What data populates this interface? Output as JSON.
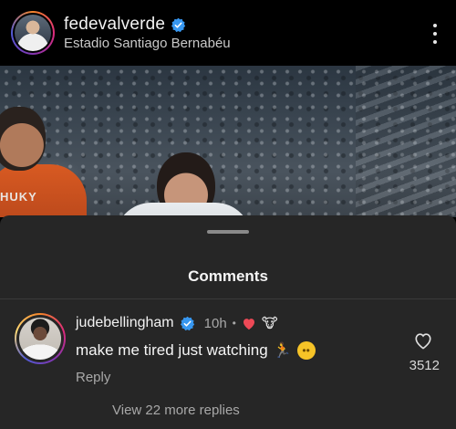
{
  "post": {
    "username": "fedevalverde",
    "location": "Estadio Santiago Bernabéu",
    "shirt_text": "HUKY"
  },
  "comments_sheet": {
    "title": "Comments",
    "comment": {
      "username": "judebellingham",
      "time": "10h",
      "separator": "•",
      "text": "make me tired just watching",
      "reply_label": "Reply",
      "like_count": "3512",
      "reactions": [
        "red-heart-icon",
        "cow-emoji-icon"
      ],
      "emojis": [
        "running-person-emoji",
        "flushed-face-emoji"
      ]
    },
    "view_replies_label": "View 22 more replies"
  },
  "colors": {
    "background": "#000000",
    "sheet": "#262626",
    "verified_blue": "#3797f0",
    "secondary_text": "#a8a8a8",
    "heart_red": "#ed4956"
  }
}
